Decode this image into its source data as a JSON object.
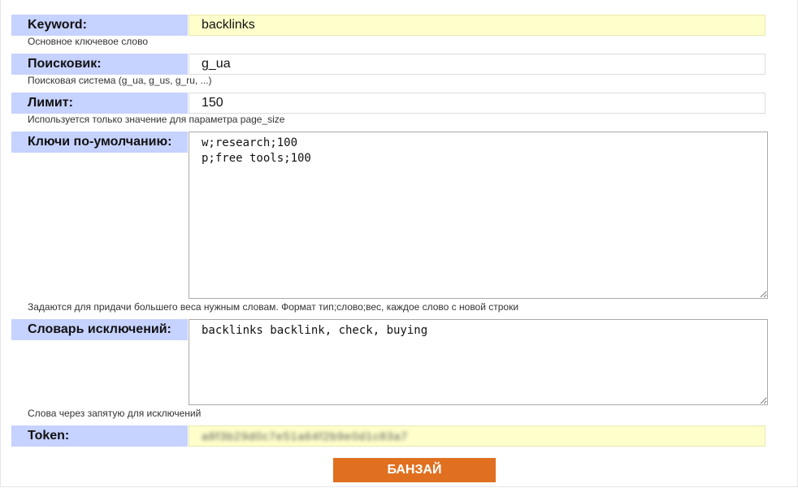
{
  "form": {
    "keyword": {
      "label": "Keyword:",
      "value": "backlinks",
      "hint": "Основное ключевое слово"
    },
    "engine": {
      "label": "Поисковик:",
      "value": "g_ua",
      "hint": "Поисковая система (g_ua, g_us, g_ru, ...)"
    },
    "limit": {
      "label": "Лимит:",
      "value": "150",
      "hint": "Используется только значение для параметра page_size"
    },
    "default_keys": {
      "label": "Ключи по-умолчанию:",
      "value": "w;research;100\np;free tools;100",
      "hint": "Задаются для придачи большего веса нужным словам. Формат тип;слово;вес, каждое слово с новой строки"
    },
    "exclusions": {
      "label": "Словарь исключений:",
      "value": "backlinks backlink, check, buying",
      "hint": "Слова через запятую для исключений"
    },
    "token": {
      "label": "Token:",
      "value": "a8f3b29d0c7e51a64f2b9e0d1c83a7"
    },
    "submit_label": "БАНЗАЙ"
  },
  "colors": {
    "label_bg": "#c6d2ff",
    "highlight_field_bg": "#ffffcc",
    "submit_bg": "#e07020"
  }
}
